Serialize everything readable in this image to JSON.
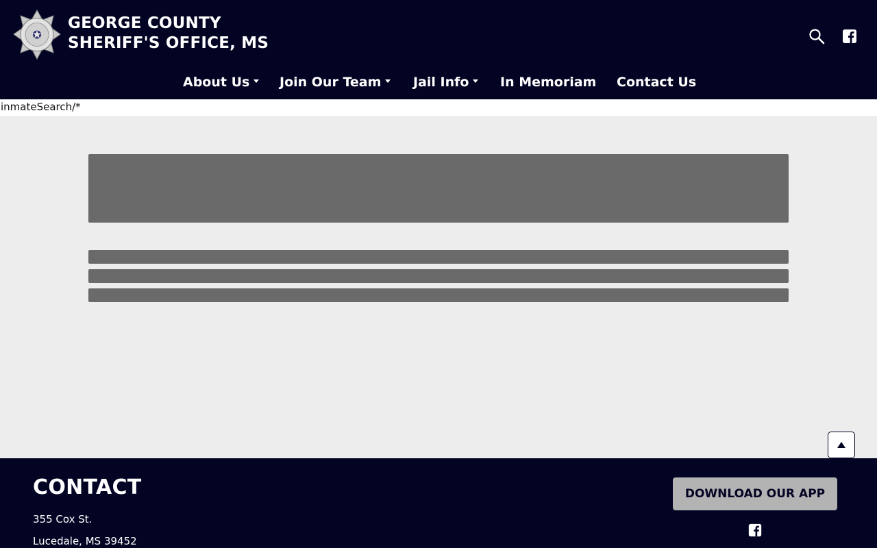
{
  "header": {
    "title_line1": "GEORGE COUNTY",
    "title_line2": "SHERIFF'S OFFICE, MS",
    "logo_icon": "sheriff-badge-logo",
    "logo_text": "GEORGE COUNTY SHERIFF MS SHERIFF'S OFFICE",
    "search_icon": "search-icon",
    "facebook_icon": "facebook-icon"
  },
  "nav": {
    "items": [
      {
        "label": "About Us",
        "has_dropdown": true
      },
      {
        "label": "Join Our Team",
        "has_dropdown": true
      },
      {
        "label": "Jail Info",
        "has_dropdown": true
      },
      {
        "label": "In Memoriam",
        "has_dropdown": false
      },
      {
        "label": "Contact Us",
        "has_dropdown": false
      }
    ]
  },
  "raw_text": "inmateSearch/*",
  "main": {
    "state": "loading-placeholders"
  },
  "back_to_top_icon": "arrow-up-icon",
  "footer": {
    "title": "CONTACT",
    "address_line1": "355 Cox St.",
    "address_line2": "Lucedale, MS 39452",
    "app_button": "DOWNLOAD OUR APP",
    "facebook_icon": "facebook-icon"
  },
  "colors": {
    "header_bg": "#030423",
    "page_bg": "#ededed",
    "placeholder": "#6a6a6a",
    "app_button_bg": "#b3b3b3"
  }
}
